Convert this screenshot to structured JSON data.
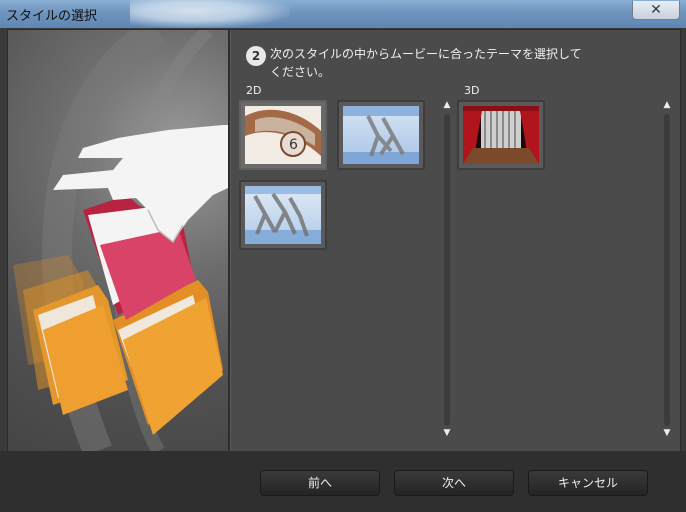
{
  "window": {
    "title": "スタイルの選択",
    "close_glyph": "✕"
  },
  "step": {
    "number": "2",
    "instruction": "次のスタイルの中からムービーに合ったテーマを選択してください。"
  },
  "sections": {
    "label_2d": "2D",
    "label_3d": "3D"
  },
  "thumbnails_2d": [
    {
      "name": "film-reel",
      "selected": true
    },
    {
      "name": "dancers-blue",
      "selected": false
    },
    {
      "name": "dancers-sky",
      "selected": false
    }
  ],
  "thumbnails_3d": [
    {
      "name": "stage-curtain",
      "selected": false
    }
  ],
  "buttons": {
    "back": "前へ",
    "next": "次へ",
    "cancel": "キャンセル"
  },
  "icons": {
    "scroll_up": "up-arrow-icon",
    "scroll_down": "down-arrow-icon",
    "close": "close-icon"
  }
}
